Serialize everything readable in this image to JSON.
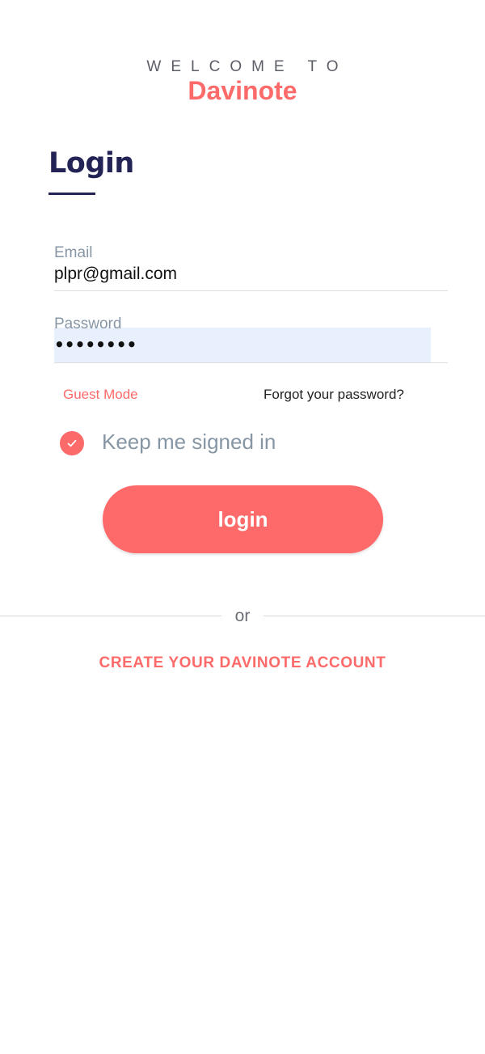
{
  "header": {
    "welcome": "WELCOME TO",
    "brand": "Davinote"
  },
  "form": {
    "title": "Login",
    "email": {
      "label": "Email",
      "value": "plpr@gmail.com"
    },
    "password": {
      "label": "Password",
      "value": "••••••••"
    },
    "guest_mode": "Guest Mode",
    "forgot_password": "Forgot your password?",
    "keep_signed_in": {
      "label": "Keep me signed in",
      "checked": true
    },
    "login_button": "login"
  },
  "divider": {
    "text": "or"
  },
  "create_account": "CREATE YOUR DAVINOTE ACCOUNT",
  "colors": {
    "accent": "#fd6a6a",
    "title": "#232356",
    "label": "#8796a5",
    "autofill": "#e8f0fe"
  }
}
